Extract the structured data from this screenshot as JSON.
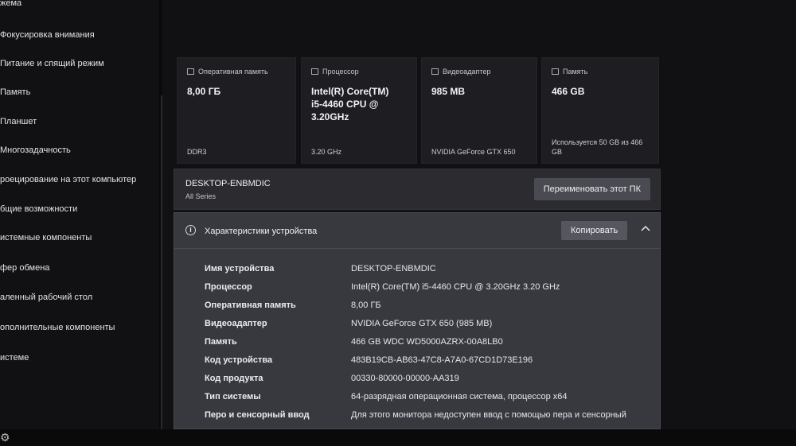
{
  "sidebar": {
    "items": [
      {
        "label": "жема"
      },
      {
        "label": "Фокусировка внимания"
      },
      {
        "label": "Питание и спящий режим"
      },
      {
        "label": "Память"
      },
      {
        "label": "Планшет"
      },
      {
        "label": "Многозадачность"
      },
      {
        "label": "роецирование на этот компьютер"
      },
      {
        "label": "бщие возможности"
      },
      {
        "label": "истемные компоненты"
      },
      {
        "label": "фер обмена"
      },
      {
        "label": "аленный рабочий стол"
      },
      {
        "label": "ополнительные компоненты"
      },
      {
        "label": "истеме"
      }
    ],
    "settings_icon": "gear-icon"
  },
  "summary_cards": [
    {
      "icon": "memory-icon",
      "title": "Оперативная память",
      "value": "8,00 ГБ",
      "sub": "DDR3"
    },
    {
      "icon": "processor-icon",
      "title": "Процессор",
      "value": "Intel(R) Core(TM)\ni5-4460  CPU @\n3.20GHz",
      "sub": "3.20 GHz"
    },
    {
      "icon": "gpu-icon",
      "title": "Видеоадаптер",
      "value": "985 MB",
      "sub": "NVIDIA GeForce GTX 650"
    },
    {
      "icon": "storage-icon",
      "title": "Память",
      "value": "466 GB",
      "sub": "Используется 50 GB из 466 GB"
    }
  ],
  "pc": {
    "name": "DESKTOP-ENBMDIC",
    "series": "All Series",
    "rename_label": "Переименовать этот ПК"
  },
  "device_specs": {
    "title": "Характеристики устройства",
    "copy_label": "Копировать",
    "rows": [
      {
        "label": "Имя устройства",
        "value": "DESKTOP-ENBMDIC"
      },
      {
        "label": "Процессор",
        "value": "Intel(R) Core(TM) i5-4460  CPU @ 3.20GHz   3.20 GHz"
      },
      {
        "label": "Оперативная память",
        "value": "8,00 ГБ"
      },
      {
        "label": "Видеоадаптер",
        "value": "NVIDIA GeForce GTX 650 (985 MB)"
      },
      {
        "label": "Память",
        "value": "466 GB WDC WD5000AZRX-00A8LB0"
      },
      {
        "label": "Код устройства",
        "value": "483B19CB-AB63-47C8-A7A0-67CD1D73E196"
      },
      {
        "label": "Код продукта",
        "value": "00330-80000-00000-AA319"
      },
      {
        "label": "Тип системы",
        "value": "64-разрядная операционная система, процессор x64"
      },
      {
        "label": "Перо и сенсорный ввод",
        "value": "Для этого монитора недоступен ввод с помощью пера и сенсорный"
      }
    ]
  }
}
